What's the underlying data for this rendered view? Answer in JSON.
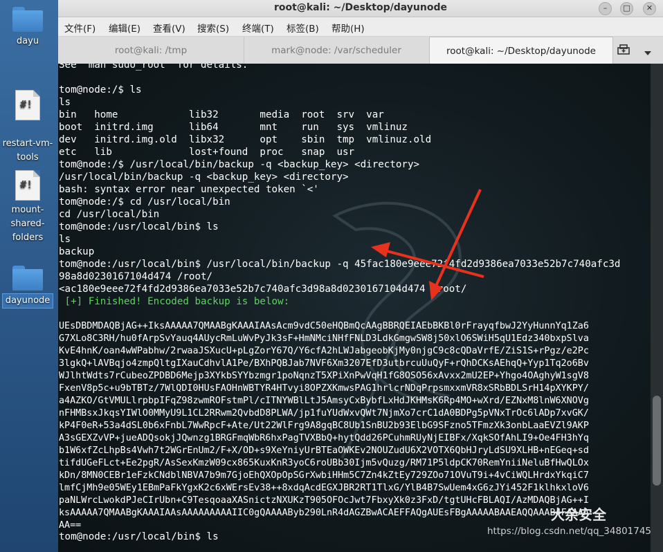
{
  "desktop": {
    "icons": [
      {
        "label": "dayu"
      },
      {
        "label": "restart-vm-\ntools"
      },
      {
        "label": "mount-\nshared-\nfolders"
      },
      {
        "label": "dayunode"
      }
    ]
  },
  "window": {
    "title": "root@kali: ~/Desktop/dayunode",
    "menu": [
      "文件(F)",
      "编辑(E)",
      "查看(V)",
      "搜索(S)",
      "终端(T)",
      "标签(B)",
      "帮助(H)"
    ],
    "tabs": [
      {
        "label": "root@kali: /tmp"
      },
      {
        "label": "mark@node: /var/scheduler"
      },
      {
        "label": "root@kali: ~/Desktop/dayunode"
      }
    ]
  },
  "terminal": {
    "lines": [
      "See \"man sudo_root\" for details.",
      "",
      "tom@node:/$ ls",
      "ls",
      "bin   home            lib32       media  root  srv  var",
      "boot  initrd.img      lib64       mnt    run   sys  vmlinuz",
      "dev   initrd.img.old  libx32      opt    sbin  tmp  vmlinuz.old",
      "etc   lib             lost+found  proc   snap  usr",
      "tom@node:/$ /usr/local/bin/backup -q <backup_key> <directory>",
      "/usr/local/bin/backup -q <backup_key> <directory>",
      "bash: syntax error near unexpected token `<'",
      "tom@node:/$ cd /usr/local/bin",
      "cd /usr/local/bin",
      "tom@node:/usr/local/bin$ ls",
      "ls",
      "backup",
      "tom@node:/usr/local/bin$ /usr/local/bin/backup -q 45fac180e9eee72f4fd2d9386ea7033e52b7c740afc3d",
      "98a8d0230167104d474 /root/",
      "<ac180e9eee72f4fd2d9386ea7033e52b7c740afc3d98a8d0230167104d474 /root/",
      " [+] Finished! Encoded backup is below:",
      ""
    ],
    "base64": [
      "UEsDBDMDAQBjAG++IksAAAAA7QMAABgKAAAIAAsAcm9vdC50eHQBmQcAAgBBRQEIAEbBKBl0rFrayqfbwJ2YyHunnYq1Za6",
      "G7XLo8C3RH/hu0fArpSvYauq4AUycRmLuWvPyJk3sF+HmNMciNHfFNLD3LdkGmgwSW8j50xlO6SWiH5qU1Edz340bxpSlva",
      "KvE4hnK/oan4wWPabhw/2rwaaJSXucU+pLgZorY67Q/Y6cfA2hLWJabgeobKjMy0njgC9c8cQDaVrfE/ZiS1S+rPgz/e2Pc",
      "3lgkQ+lAVBqjo4zmpQltgIXauCdhvlA1Pe/BXhPQBJab7NVF6Xm3207EfD3utbrcuUuQyF+rQhDCKsAEhqQ+Yyp1Tq2o6Bv",
      "WJlhtWdts7rCubeoZPDBD6Mejp3XYkbSYYbzmgr1poNqnzT5XPiXnPwVqH1fG8OSO56xAvxx2mU2EP+Yhgo4OAghyW1sgV8",
      "FxenV8p5c+u9bTBTz/7WlQDI0HUsFAOHnWBTYR4HTvyi8OPZXKmwsPAG1hrlcrNDqPrpsmxxmVR8xSRbBDLSrH14pXYKPY/",
      "a4AZKO/GtVMULlrpbpIFqZ98zwmROFstmPl/cITNYWBlLtJ5AmsyCxBybfLxHdJKHMsK6Rp4MO+wXrd/EZNxM8lnW6XNOVg",
      "nFHMBsxJkqsYIWlO0MMyU9L1CL2RRwm2QvbdD8PLWA/jp1fuYUdWxvQWt7NjmXo7crC1dA0BDPg5pVNxTrOc6lADp7xvGK/",
      "kP4F0eR+53a4dSL0b6xFnbL7WwRpcF+Ate/Ut22WlFrg9A8gqBC8Ub1SnBU2b93ElbG9SFzno5TFmzXk3onbLaaEVZl9AKP",
      "A3sGEXZvVP+jueADQsokjJQwnzg1BRGFmqWbR6hxPagTVXBbQ+hytQdd26PCuhmRUyNjEIBFx/XqkSOfAhLI9+Oe4FH3hYq",
      "b1W6xfZcLhpBs4Vwh7t2WGrEnUm2/F+X/OD+s9XeYniyUrBTEaOWKEv2NOUZudU6X2VOTX6QbHJryLdSU9XLHB+nEGeq+sd",
      "tifdUGeFLct+Ee2pgR/AsSexKmzW09cx865KuxKnR3yoC6roUBb30Ijm5vQuzg/RM71P5ldpCK70RemYniiNeluBfHwQLOx",
      "kDn/8MN0CEBr1eFzkCNdblNBVA7b9m7GjoEhQXOpOpSGrXwbiHHm5C7Zn4kZtEy729ZOo71OVuT9i+4vCiWQLHrdxYkqiC7",
      "lmfCjMh9e05WEy1EBmPaFkYgxK2c6xWErsEv38++8xdqAcdEGXJBR2RT1TlxG/YlB4B7SwUem4xG6zJYi452F1klhkxloV6",
      "paNLWrcLwokdPJeCIrUbn+C9TesqoaaXASnictzNXUKzT905OFOcJwt7FbxyXk0z3FxD/tgtUHcFBLAQI/AzMDAQBjAG++I",
      "ksAAAAA7QMAABgKAAAIAAsAAAAAAAAAIIC0gQAAAAByb290LnR4dAGZBwACAEFFAQgAUEsFBgAAAAABAAEAQQAAAB4FAAAA",
      "AA=="
    ],
    "prompt_last": "tom@node:/usr/local/bin$ ls"
  },
  "watermark": {
    "brand": "大余安全",
    "url": "https://blog.csdn.net/qq_34801745"
  },
  "colors": {
    "terminal_bg": "#111a1e",
    "prompt_green": "#5fd35f",
    "arrow_red": "#e8321e"
  }
}
